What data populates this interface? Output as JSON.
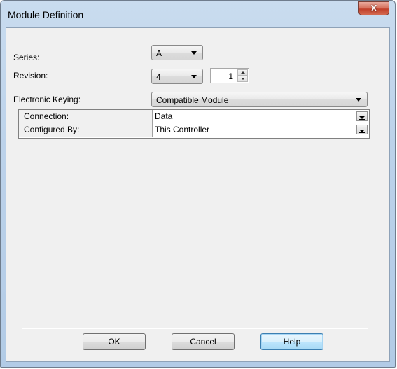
{
  "window": {
    "title": "Module Definition",
    "close_label": "X"
  },
  "series": {
    "label": "Series:",
    "value": "A"
  },
  "revision": {
    "label": "Revision:",
    "major_value": "4",
    "minor_value": "1"
  },
  "keying": {
    "label": "Electronic Keying:",
    "value": "Compatible Module"
  },
  "properties": [
    {
      "name": "Connection:",
      "value": "Data"
    },
    {
      "name": "Configured By:",
      "value": "This Controller"
    }
  ],
  "buttons": {
    "ok": "OK",
    "cancel": "Cancel",
    "help": "Help"
  },
  "colors": {
    "titlebar": "#bcd2ea",
    "client": "#f0f0f0",
    "close": "#c1402a",
    "default_button": "#bee6fd"
  },
  "icons": {
    "close": "close-icon",
    "dropdown": "chevron-down-icon",
    "spin_up": "spin-up-icon",
    "spin_down": "spin-down-icon"
  }
}
